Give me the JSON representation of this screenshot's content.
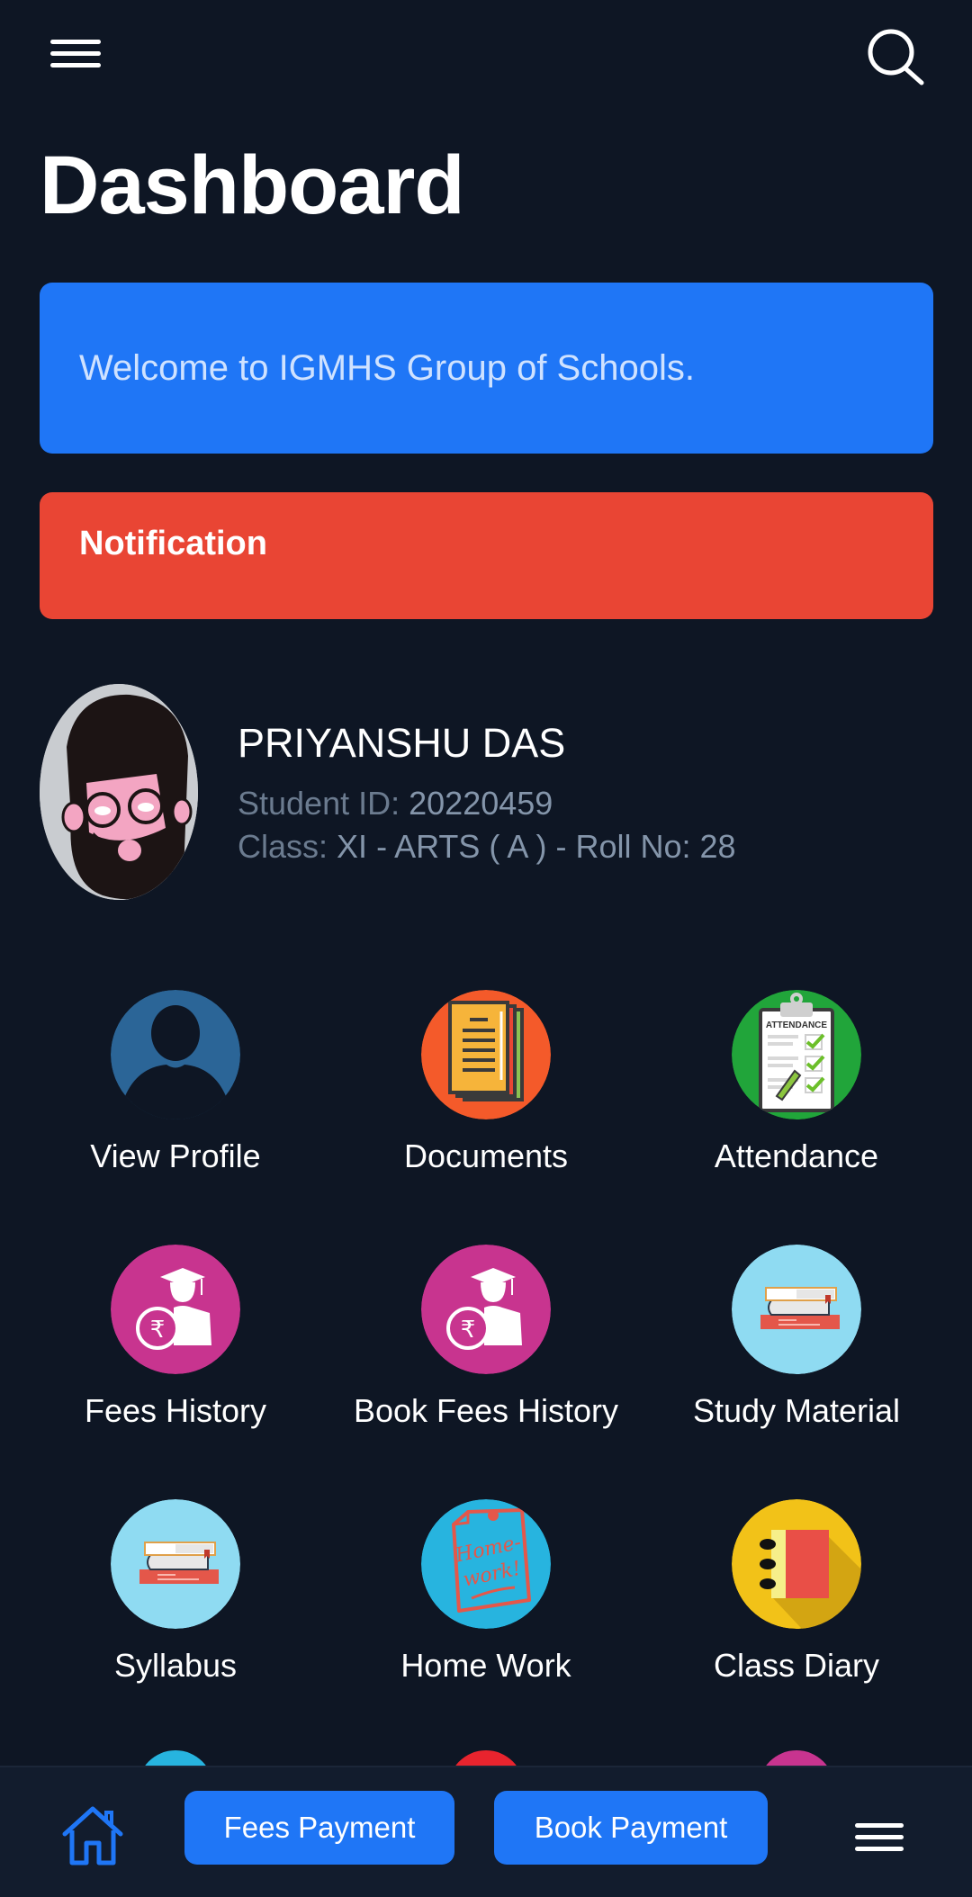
{
  "header": {
    "title": "Dashboard",
    "menu_icon": "hamburger-menu-icon",
    "search_icon": "search-icon"
  },
  "welcome": {
    "text": "Welcome to IGMHS Group of Schools.",
    "color": "#1f76f6"
  },
  "notification": {
    "title": "Notification",
    "color": "#e94534"
  },
  "student": {
    "name": "PRIYANSHU DAS",
    "id_label": "Student ID:",
    "id_value": "20220459",
    "class_label": "Class:",
    "class_value": "XI - ARTS ( A ) - Roll No: 28",
    "avatar_icon": "cartoon-avatar"
  },
  "menu_tiles": [
    {
      "label": "View Profile",
      "icon": "user-profile-icon",
      "color": "#2b6597"
    },
    {
      "label": "Documents",
      "icon": "documents-icon",
      "color": "#f45a2a"
    },
    {
      "label": "Attendance",
      "icon": "attendance-clipboard-icon",
      "color": "#21a53a"
    },
    {
      "label": "Fees History",
      "icon": "fees-graduate-rupee-icon",
      "color": "#c8348f"
    },
    {
      "label": "Book Fees History",
      "icon": "fees-graduate-rupee-icon",
      "color": "#c8348f"
    },
    {
      "label": "Study Material",
      "icon": "books-stack-icon",
      "color": "#8fdbf2"
    },
    {
      "label": "Syllabus",
      "icon": "books-stack-icon",
      "color": "#8fdbf2"
    },
    {
      "label": "Home Work",
      "icon": "homework-note-icon",
      "color": "#27b4df"
    },
    {
      "label": "Class Diary",
      "icon": "diary-notebook-icon",
      "color": "#f2c218"
    }
  ],
  "partial_tiles": [
    {
      "color": "#27b4df"
    },
    {
      "color": "#e8242e"
    },
    {
      "color": "#c8348f"
    }
  ],
  "bottom_bar": {
    "home_icon": "home-icon",
    "fees_payment_label": "Fees Payment",
    "book_payment_label": "Book Payment",
    "menu_icon": "hamburger-menu-icon"
  }
}
